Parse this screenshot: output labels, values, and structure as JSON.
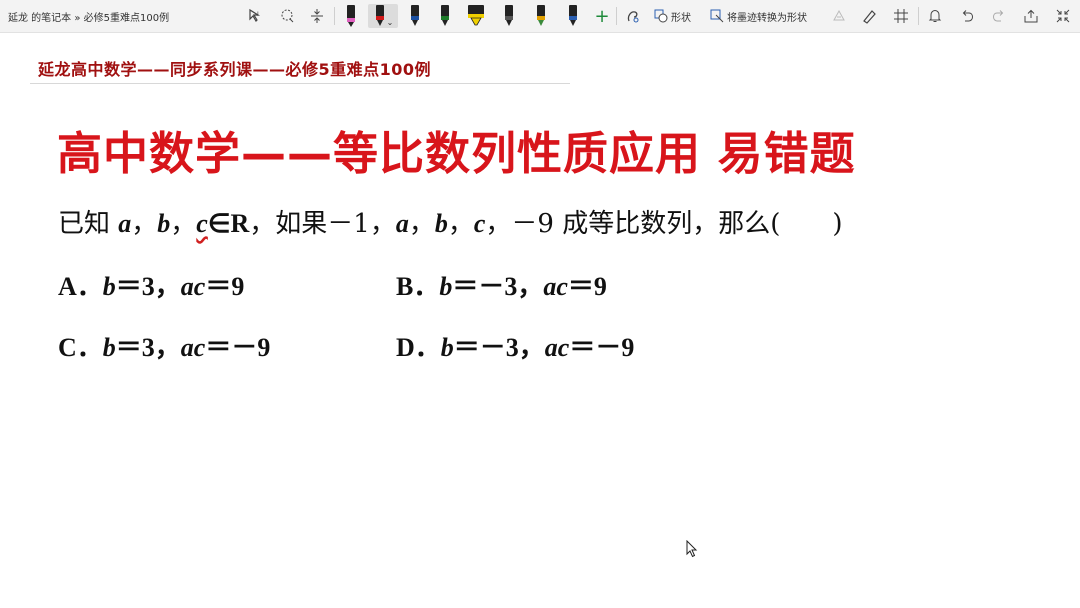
{
  "toolbar": {
    "breadcrumb": "延龙 的笔记本 » 必修5重难点100例",
    "shape_label": "形状",
    "ink_to_shape_label": "将墨迹转换为形状",
    "pens": [
      {
        "color": "#222222"
      },
      {
        "color": "#d01818"
      },
      {
        "color": "#1a4fa0"
      },
      {
        "color": "#1e7a2a"
      },
      {
        "color": "#f0d000"
      },
      {
        "color": "#2b2b2b"
      },
      {
        "color": "#e0a000"
      },
      {
        "color": "#2b5fb0"
      }
    ]
  },
  "page": {
    "series_header": "延龙高中数学——同步系列课——必修5重难点100例",
    "title": "高中数学——等比数列性质应用 易错题",
    "problem": {
      "prefix": "已知 ",
      "a": "a",
      "sep1": "，",
      "b": "b",
      "sep2": "，",
      "c": "c",
      "in_R": "∈R",
      "mid": "，如果－1，",
      "a2": "a",
      "sep3": "，",
      "b2": "b",
      "sep4": "，",
      "c2": "c",
      "tail": "，－9 成等比数列，那么(　　)"
    },
    "options": [
      {
        "letter": "A．",
        "v1": "b",
        "e1": "＝3，",
        "v2": "ac",
        "e2": "＝9"
      },
      {
        "letter": "B．",
        "v1": "b",
        "e1": "＝－3，",
        "v2": "ac",
        "e2": "＝9"
      },
      {
        "letter": "C．",
        "v1": "b",
        "e1": "＝3，",
        "v2": "ac",
        "e2": "＝－9"
      },
      {
        "letter": "D．",
        "v1": "b",
        "e1": "＝－3，",
        "v2": "ac",
        "e2": "＝－9"
      }
    ]
  },
  "colors": {
    "series_header": "#a01010",
    "title": "#d8151b"
  }
}
